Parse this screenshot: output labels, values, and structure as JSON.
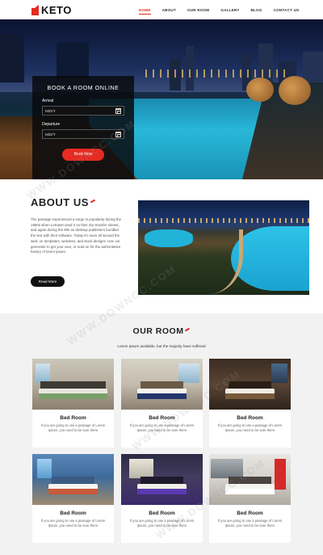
{
  "brand": {
    "name": "KETO",
    "accent": "#e52b22"
  },
  "nav": {
    "items": [
      {
        "label": "HOME",
        "active": true
      },
      {
        "label": "ABOUT",
        "active": false
      },
      {
        "label": "OUR ROOM",
        "active": false
      },
      {
        "label": "GALLERY",
        "active": false
      },
      {
        "label": "BLOG",
        "active": false
      },
      {
        "label": "CONTACT US",
        "active": false
      }
    ]
  },
  "booking": {
    "title": "BOOK A ROOM ONLINE",
    "arrival_label": "Arrival",
    "arrival_value": "M/D/Y",
    "departure_label": "Departure",
    "departure_value": "M/D/Y",
    "button": "Book Now"
  },
  "about": {
    "title": "ABOUT US",
    "text": "The passage experienced a surge in popularity during the 1960s when Letraset used it on their dry-transfer sheets, and again during the 90s as desktop publishers bundled the text with their software. Today it's seen all around the web; on templates, websites, and stock designs. Use our generator to get your own, or read on for the authoritative history of lorem ipsum.",
    "button": "Read More"
  },
  "rooms": {
    "title": "OUR ROOM",
    "subtitle": "Lorem Ipsum available, but the majority have suffered",
    "items": [
      {
        "name": "Bed Room",
        "desc": "If you are going to use a passage of Lorem Ipsum, you need to be sure there"
      },
      {
        "name": "Bed Room",
        "desc": "If you are going to use a passage of Lorem Ipsum, you need to be sure there"
      },
      {
        "name": "Bed Room",
        "desc": "If you are going to use a passage of Lorem Ipsum, you need to be sure there"
      },
      {
        "name": "Bed Room",
        "desc": "If you are going to use a passage of Lorem Ipsum, you need to be sure there"
      },
      {
        "name": "Bed Room",
        "desc": "If you are going to use a passage of Lorem Ipsum, you need to be sure there"
      },
      {
        "name": "Bed Room",
        "desc": "If you are going to use a passage of Lorem Ipsum, you need to be sure there"
      }
    ]
  },
  "watermark": "WWW.DOWNCC.COM"
}
